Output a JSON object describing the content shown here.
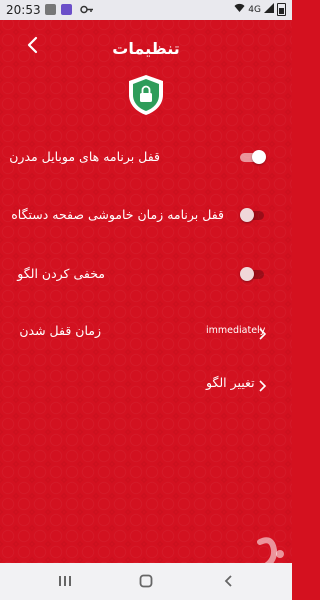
{
  "status_bar": {
    "time": "20:53",
    "network": "4G",
    "signal": "LTE"
  },
  "header": {
    "title": "تنظیمات",
    "back_icon": "chevron-left-icon",
    "shield_icon": "shield-lock-icon"
  },
  "settings": {
    "modern_apps_lock": {
      "label": "قفل برنامه های موبایل مدرن",
      "enabled": true
    },
    "screen_off_lock": {
      "label": "قفل برنامه زمان خاموشی صفحه دستگاه",
      "enabled": false
    },
    "hide_pattern": {
      "label": "مخفی کردن الگو",
      "enabled": false
    },
    "lock_time": {
      "label": "زمان قفل شدن",
      "value": "immediately"
    },
    "change_pattern": {
      "label": "تغییر الگو"
    }
  },
  "nav_bar": {
    "recents_icon": "recents-icon",
    "home_icon": "home-icon",
    "back_icon": "back-icon"
  },
  "colors": {
    "background": "#d31120",
    "text": "#ffffff",
    "shield_green": "#2e9c5a"
  }
}
